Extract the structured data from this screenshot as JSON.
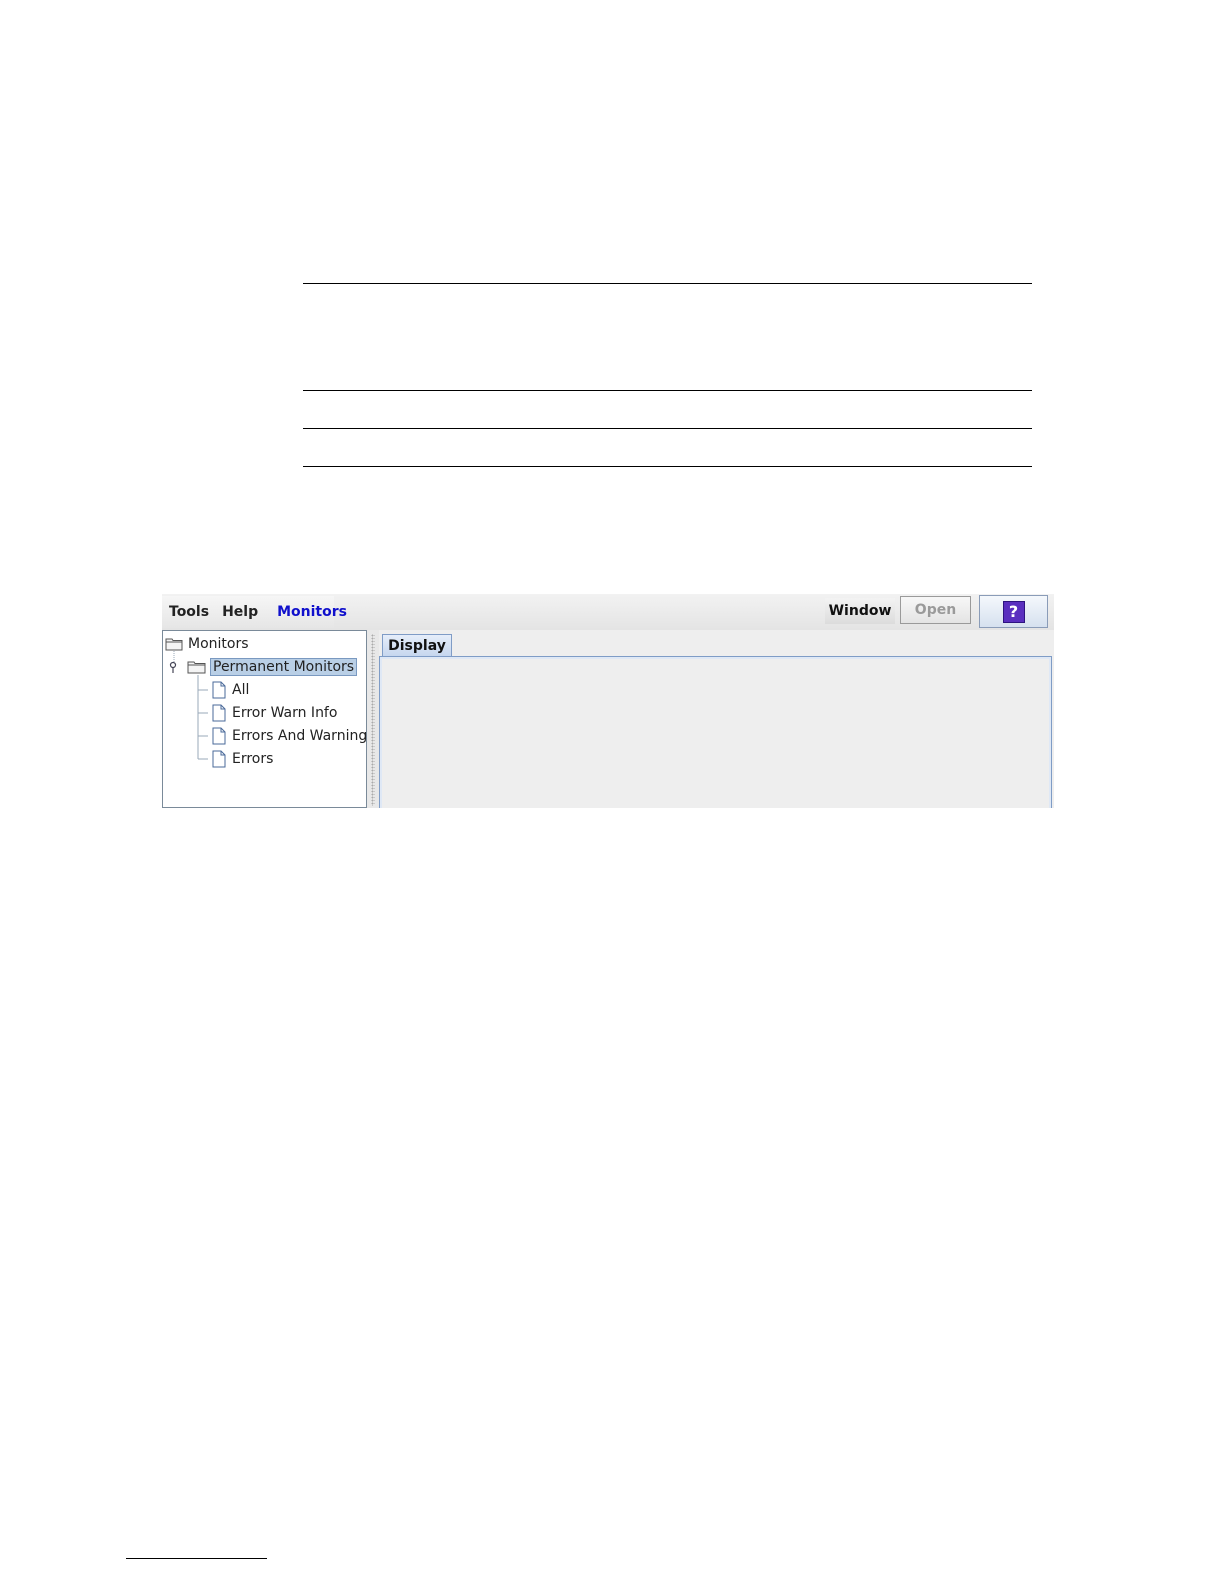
{
  "menubar": {
    "items": [
      {
        "label": "Tools"
      },
      {
        "label": "Help"
      },
      {
        "label": "Monitors"
      }
    ],
    "window_button": "Window",
    "open_button": "Open",
    "help_button_glyph": "?"
  },
  "tree": {
    "root": "Monitors",
    "group": "Permanent Monitors",
    "children": [
      "All",
      "Error Warn Info",
      "Errors And Warnings",
      "Errors"
    ]
  },
  "tabs": [
    {
      "label": "Display",
      "selected": true
    }
  ],
  "colors": {
    "active_menu": "#1010cc",
    "selection": "#b9cfe6",
    "help_icon": "#5a2fbf"
  },
  "icons": [
    "folder-icon",
    "document-icon",
    "tree-expand-handle-icon",
    "help-icon"
  ]
}
